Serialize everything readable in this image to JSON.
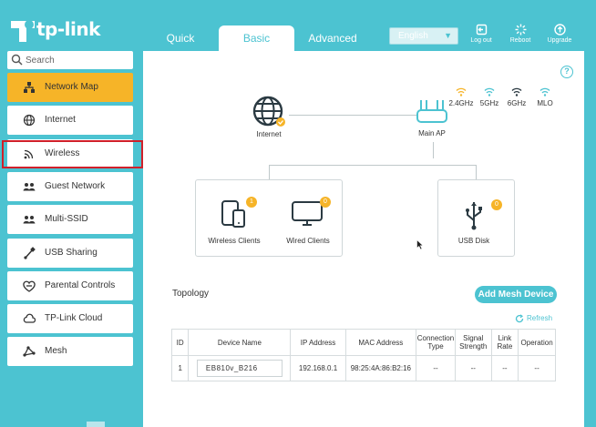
{
  "brand": {
    "logo_text": "tp-link",
    "accent": "#4cc3d1",
    "highlight": "#f6b428"
  },
  "nav": {
    "tabs": [
      {
        "label": "Quick Setup",
        "active": false
      },
      {
        "label": "Basic",
        "active": true
      },
      {
        "label": "Advanced",
        "active": false
      }
    ],
    "language": "English",
    "buttons": [
      {
        "label": "Log out",
        "icon": "logout-icon"
      },
      {
        "label": "Reboot",
        "icon": "reboot-icon"
      },
      {
        "label": "Upgrade",
        "icon": "upgrade-icon"
      }
    ]
  },
  "sidebar": {
    "search_placeholder": "Search",
    "items": [
      {
        "label": "Network Map",
        "icon": "network-map-icon",
        "active": true
      },
      {
        "label": "Internet",
        "icon": "globe-icon",
        "active": false
      },
      {
        "label": "Wireless",
        "icon": "wireless-icon",
        "active": false
      },
      {
        "label": "Guest Network",
        "icon": "guest-network-icon",
        "active": false
      },
      {
        "label": "Multi-SSID",
        "icon": "multi-ssid-icon",
        "active": false
      },
      {
        "label": "USB Sharing",
        "icon": "usb-sharing-icon",
        "active": false
      },
      {
        "label": "Parental Controls",
        "icon": "heart-shield-icon",
        "active": false
      },
      {
        "label": "TP-Link Cloud",
        "icon": "cloud-icon",
        "active": false
      },
      {
        "label": "Mesh",
        "icon": "mesh-icon",
        "active": false
      }
    ]
  },
  "map": {
    "help": "?",
    "internet_label": "Internet",
    "main_ap_label": "Main AP",
    "bands": [
      "2.4GHz",
      "5GHz",
      "6GHz",
      "MLO"
    ],
    "wireless_clients": {
      "label": "Wireless Clients",
      "count": "1"
    },
    "wired_clients": {
      "label": "Wired Clients",
      "count": "0"
    },
    "usb_disk": {
      "label": "USB Disk",
      "count": "0"
    }
  },
  "topology": {
    "title": "Topology",
    "add_button": "Add Mesh Device",
    "refresh": "Refresh",
    "columns": [
      "ID",
      "Device Name",
      "IP Address",
      "MAC Address",
      "Connection Type",
      "Signal Strength",
      "Link Rate",
      "Operation"
    ],
    "rows": [
      {
        "id": "1",
        "name": "EB810v_B216",
        "ip": "192.168.0.1",
        "mac": "98:25:4A:86:B2:16",
        "connection": "--",
        "signal": "--",
        "link_rate": "--",
        "operation": "--"
      }
    ]
  }
}
